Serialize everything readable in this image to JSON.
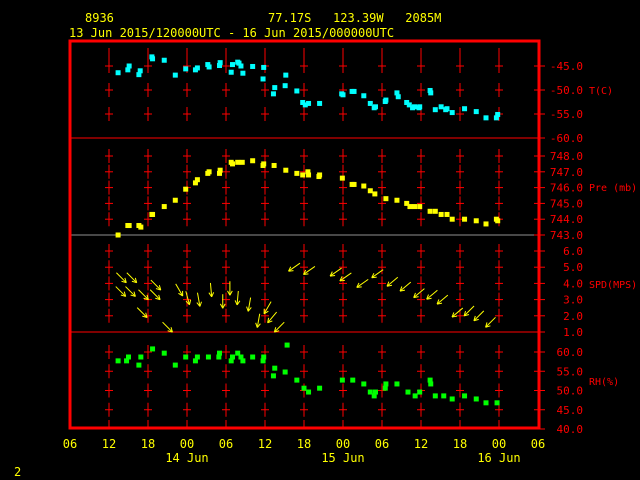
{
  "header": {
    "station": "8936",
    "location": "77.17S   123.39W   2085M",
    "time_range": "13 Jun 2015/120000UTC - 16 Jun 2015/000000UTC"
  },
  "page_number": "2",
  "colors": {
    "frame": "#ff0000",
    "text": "#ffff00",
    "temp": "#00ffff",
    "pres": "#ffff00",
    "wind": "#ffff00",
    "rh": "#00ff00"
  },
  "chart_data": [
    {
      "type": "scatter",
      "title": "T(C)",
      "ylabel": "T(C)",
      "x_units": "hours since 13 Jun 2015 12UTC",
      "ylim": [
        -60,
        -42
      ],
      "yticks": [
        "-45.0",
        "-50.0",
        "-55.0",
        "-60.0"
      ],
      "ytick_values": [
        -45,
        -50,
        -55,
        -60
      ],
      "x": [
        1.4,
        2.9,
        3.1,
        4.8,
        4.6,
        6.6,
        6.7,
        8.5,
        10.2,
        11.8,
        13.3,
        13.6,
        15.2,
        15.4,
        17.0,
        17.1,
        18.8,
        19.0,
        19.8,
        20.0,
        20.3,
        20.6,
        22.1,
        23.8,
        23.7,
        25.5,
        25.3,
        27.1,
        27.2,
        28.9,
        29.8,
        30.2,
        30.7,
        32.4,
        35.8,
        36.0,
        37.4,
        37.7,
        39.2,
        40.2,
        40.8,
        41.0,
        42.5,
        42.6,
        44.3,
        44.5,
        45.8,
        46.2,
        46.7,
        47.0,
        47.7,
        47.8,
        49.4,
        49.5,
        50.2,
        51.1,
        51.8,
        52.0,
        52.8,
        54.7,
        56.5,
        58.0,
        59.6,
        59.8
      ],
      "y": [
        -46.4,
        -45.8,
        -45.0,
        -46.0,
        -46.8,
        -43.1,
        -43.5,
        -43.8,
        -46.9,
        -45.6,
        -45.8,
        -45.4,
        -44.7,
        -45.2,
        -44.9,
        -44.3,
        -46.3,
        -44.7,
        -44.2,
        -44.4,
        -45.0,
        -46.5,
        -45.1,
        -45.3,
        -47.7,
        -49.5,
        -50.8,
        -49.1,
        -46.9,
        -50.2,
        -52.6,
        -53.1,
        -52.8,
        -52.8,
        -50.8,
        -51.0,
        -50.3,
        -50.3,
        -51.2,
        -52.8,
        -53.7,
        -53.5,
        -52.4,
        -52.1,
        -50.6,
        -51.4,
        -52.6,
        -53.1,
        -53.7,
        -53.5,
        -53.7,
        -53.5,
        -50.1,
        -50.6,
        -54.1,
        -53.5,
        -54.1,
        -53.9,
        -54.7,
        -53.9,
        -54.5,
        -55.8,
        -55.8,
        -55.1
      ]
    },
    {
      "type": "scatter",
      "title": "Pre (mb)",
      "ylabel": "Pre (mb)",
      "x_units": "hours since 13 Jun 2015 12UTC",
      "ylim": [
        743,
        748.9
      ],
      "yticks": [
        "748.0",
        "747.0",
        "746.0",
        "745.0",
        "744.0",
        "743.0"
      ],
      "ytick_values": [
        748,
        747,
        746,
        745,
        744,
        743
      ],
      "x": [
        1.4,
        2.9,
        3.1,
        4.6,
        4.9,
        6.6,
        6.7,
        8.5,
        10.2,
        11.8,
        13.3,
        13.6,
        15.2,
        15.4,
        17.0,
        17.1,
        18.8,
        19.0,
        19.8,
        20.5,
        22.1,
        23.7,
        23.8,
        25.4,
        27.2,
        28.9,
        29.8,
        30.6,
        30.7,
        32.4,
        32.3,
        35.9,
        37.4,
        37.7,
        39.2,
        40.2,
        40.9,
        42.6,
        44.3,
        45.8,
        46.3,
        47.0,
        47.8,
        49.4,
        50.2,
        51.1,
        52.0,
        52.8,
        54.7,
        56.5,
        58.0,
        59.6,
        59.8
      ],
      "y": [
        743.0,
        743.6,
        743.6,
        743.6,
        743.5,
        744.3,
        744.3,
        744.8,
        745.2,
        745.9,
        746.3,
        746.5,
        746.9,
        747.0,
        746.9,
        747.1,
        747.6,
        747.5,
        747.6,
        747.6,
        747.7,
        747.4,
        747.5,
        747.4,
        747.1,
        746.9,
        746.8,
        747.0,
        746.8,
        746.8,
        746.7,
        746.6,
        746.2,
        746.2,
        746.1,
        745.8,
        745.6,
        745.3,
        745.2,
        745.0,
        744.8,
        744.8,
        744.8,
        744.5,
        744.5,
        744.3,
        744.3,
        744.0,
        744.0,
        743.9,
        743.7,
        744.0,
        743.9
      ]
    },
    {
      "type": "scatter",
      "title": "SPD(MPS)",
      "ylabel": "SPD(MPS)",
      "marker": "wind-arrow",
      "x_units": "hours since 13 Jun 2015 12UTC",
      "ylim": [
        1,
        6.4
      ],
      "yticks": [
        "6.0",
        "5.0",
        "4.0",
        "3.0",
        "2.0",
        "1.0"
      ],
      "ytick_values": [
        6,
        5,
        4,
        3,
        2,
        1
      ],
      "x": [
        1.9,
        3.5,
        1.8,
        3.3,
        5.3,
        7.2,
        7.1,
        5.1,
        9.0,
        10.8,
        12.1,
        13.8,
        15.7,
        17.5,
        18.6,
        19.8,
        21.6,
        23.0,
        24.4,
        25.1,
        26.2,
        28.5,
        30.8,
        34.9,
        36.4,
        39.0,
        41.3,
        43.6,
        45.6,
        47.7,
        49.7,
        51.3,
        53.6,
        55.4,
        56.9,
        58.7
      ],
      "y": [
        4.35,
        4.35,
        3.5,
        3.5,
        3.3,
        3.9,
        3.3,
        2.2,
        1.3,
        3.6,
        3.1,
        3.0,
        3.6,
        2.9,
        3.7,
        3.1,
        2.7,
        1.7,
        2.5,
        1.9,
        1.3,
        5.0,
        4.8,
        4.7,
        4.4,
        4.0,
        4.6,
        4.1,
        3.8,
        3.4,
        3.3,
        3.0,
        2.2,
        2.3,
        2.0,
        1.6
      ],
      "direction_deg": [
        315,
        315,
        315,
        315,
        315,
        315,
        315,
        315,
        315,
        330,
        345,
        350,
        355,
        0,
        0,
        5,
        10,
        10,
        30,
        40,
        45,
        55,
        55,
        55,
        55,
        55,
        55,
        50,
        50,
        50,
        50,
        50,
        50,
        45,
        45,
        45
      ]
    },
    {
      "type": "scatter",
      "title": "RH(%)",
      "ylabel": "RH(%)",
      "x_units": "hours since 13 Jun 2015 12UTC",
      "ylim": [
        40,
        64
      ],
      "yticks": [
        "60.0",
        "55.0",
        "50.0",
        "45.0",
        "40.0"
      ],
      "ytick_values": [
        60,
        55,
        50,
        45,
        40
      ],
      "x": [
        1.4,
        2.7,
        3.0,
        4.6,
        4.9,
        6.7,
        8.5,
        10.2,
        11.8,
        13.3,
        13.6,
        15.3,
        17.0,
        16.9,
        18.8,
        19.0,
        19.8,
        20.3,
        20.6,
        22.1,
        23.7,
        23.8,
        27.4,
        25.5,
        25.3,
        27.1,
        28.9,
        30.0,
        30.7,
        32.4,
        35.9,
        37.5,
        39.2,
        40.2,
        40.8,
        41.0,
        42.5,
        42.6,
        44.3,
        46.0,
        47.1,
        47.8,
        49.4,
        49.5,
        50.2,
        51.5,
        52.8,
        54.7,
        56.5,
        58.0,
        59.7
      ],
      "y": [
        57.7,
        57.7,
        58.7,
        56.6,
        58.7,
        60.8,
        59.7,
        56.6,
        58.7,
        57.7,
        58.7,
        58.7,
        59.7,
        58.7,
        57.7,
        58.7,
        59.7,
        58.7,
        57.7,
        58.7,
        57.7,
        58.7,
        61.8,
        55.8,
        53.8,
        54.8,
        52.7,
        50.6,
        49.6,
        50.6,
        52.7,
        52.7,
        51.7,
        49.6,
        48.6,
        49.6,
        50.6,
        51.7,
        51.7,
        49.6,
        48.6,
        49.6,
        52.7,
        51.7,
        48.6,
        48.6,
        47.8,
        48.6,
        47.8,
        46.8,
        46.8
      ]
    }
  ],
  "x_axis": {
    "ticks": [
      "06",
      "12",
      "18",
      "00",
      "06",
      "12",
      "18",
      "00",
      "06",
      "12",
      "18",
      "00",
      "06"
    ],
    "tick_hours": [
      -6,
      0,
      6,
      12,
      18,
      24,
      30,
      36,
      42,
      48,
      54,
      60,
      66
    ],
    "dates": [
      {
        "label": "14 Jun",
        "hour": 12
      },
      {
        "label": "15 Jun",
        "hour": 36
      },
      {
        "label": "16 Jun",
        "hour": 60
      }
    ]
  }
}
